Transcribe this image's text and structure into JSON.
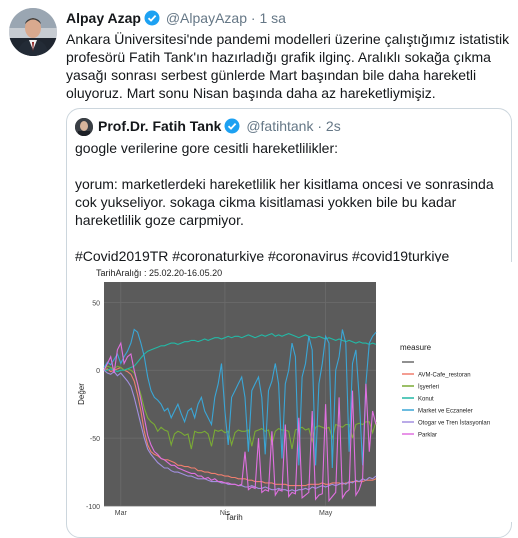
{
  "tweet": {
    "author_name": "Alpay Azap",
    "author_handle": "@AlpayAzap",
    "separator": "·",
    "time": "1 sa",
    "text": "Ankara Üniversitesi'nde pandemi modelleri üzerine çalıştığımız istatistik profesörü Fatih Tank'ın hazırladığı  grafik ilginç. Aralıklı sokağa çıkma yasağı sonrası serbest günlerde Mart başından bile daha hareketli oluyoruz. Mart sonu Nisan başında daha az hareketliymişiz."
  },
  "quote": {
    "author_name": "Prof.Dr. Fatih Tank",
    "author_handle": "@fatihtank",
    "separator": "·",
    "time": "2s",
    "text": "google verilerine gore cesitli hareketlilikler:\n\nyorum: marketlerdeki hareketlilik her kisitlama oncesi ve sonrasinda cok yukseliyor. sokaga cikma kisitlamasi yokken bile bu kadar hareketlilik goze carpmiyor.\n\n#Covid2019TR #coronaturkiye #coronavirus #covid19turkiye"
  },
  "chart_data": {
    "type": "line",
    "title": "TarihAralığı : 25.02.20-16.05.20",
    "xlabel": "Tarih",
    "ylabel": "Değer",
    "x_ticks": [
      "Mar",
      "Nis",
      "May"
    ],
    "y_ticks": [
      -100,
      -50,
      0,
      50
    ],
    "ylim": [
      -100,
      65
    ],
    "x_start": "2020-02-25",
    "x_end": "2020-05-16",
    "legend_title": "measure",
    "legend_position": "right",
    "series": [
      {
        "name": "AVM-Cafe_restoran",
        "color": "#f07e6e",
        "values": [
          0,
          1,
          -1,
          0,
          1,
          2,
          0,
          -1,
          -3,
          -8,
          -18,
          -30,
          -45,
          -55,
          -60,
          -62,
          -63,
          -65,
          -66,
          -66,
          -67,
          -68,
          -70,
          -70,
          -71,
          -71,
          -72,
          -72,
          -74,
          -74,
          -75,
          -75,
          -76,
          -76,
          -77,
          -77,
          -78,
          -78,
          -79,
          -79,
          -80,
          -80,
          -80,
          -81,
          -81,
          -82,
          -82,
          -82,
          -83,
          -83,
          -83,
          -84,
          -84,
          -84,
          -84,
          -85,
          -85,
          -85,
          -85,
          -85,
          -85,
          -84,
          -84,
          -84,
          -84,
          -83,
          -84,
          -84,
          -83,
          -83,
          -83,
          -84,
          -83,
          -83,
          -82,
          -82,
          -82,
          -82,
          -81,
          -81,
          -81,
          -80
        ]
      },
      {
        "name": "İşyerleri",
        "color": "#7aab35",
        "values": [
          0,
          3,
          2,
          1,
          3,
          2,
          0,
          1,
          0,
          -2,
          -10,
          -18,
          -28,
          -35,
          -38,
          -40,
          -45,
          -42,
          -44,
          -45,
          -55,
          -47,
          -45,
          -46,
          -48,
          -47,
          -58,
          -45,
          -46,
          -46,
          -45,
          -47,
          -56,
          -44,
          -45,
          -44,
          -46,
          -45,
          -55,
          -46,
          -44,
          -45,
          -45,
          -44,
          -56,
          -45,
          -44,
          -43,
          -45,
          -44,
          -55,
          -45,
          -43,
          -44,
          -44,
          -45,
          -58,
          -44,
          -43,
          -42,
          -44,
          -43,
          -52,
          -42,
          -41,
          -42,
          -43,
          -42,
          -50,
          -40,
          -41,
          -42,
          -40,
          -40,
          -50,
          -40,
          -39,
          -40,
          -38,
          -38,
          -46,
          -38
        ]
      },
      {
        "name": "Konut",
        "color": "#23b9a6",
        "values": [
          0,
          0,
          1,
          0,
          -1,
          0,
          0,
          1,
          2,
          3,
          6,
          9,
          12,
          14,
          15,
          16,
          17,
          18,
          18,
          19,
          20,
          20,
          19,
          20,
          21,
          21,
          22,
          22,
          21,
          22,
          23,
          22,
          23,
          24,
          24,
          23,
          24,
          25,
          24,
          25,
          25,
          24,
          25,
          26,
          25,
          24,
          25,
          26,
          25,
          26,
          27,
          25,
          26,
          25,
          26,
          27,
          26,
          25,
          24,
          25,
          26,
          25,
          24,
          24,
          25,
          24,
          23,
          24,
          23,
          22,
          23,
          22,
          21,
          22,
          21,
          20,
          21,
          20,
          20,
          19,
          20,
          19
        ]
      },
      {
        "name": "Market ve Eczaneler",
        "color": "#3aa6d6",
        "values": [
          2,
          6,
          4,
          8,
          12,
          5,
          10,
          14,
          20,
          30,
          28,
          20,
          10,
          -5,
          -15,
          -20,
          -22,
          -25,
          -30,
          -28,
          -35,
          -30,
          -25,
          -32,
          -38,
          -30,
          -28,
          -35,
          -25,
          -20,
          -30,
          -35,
          -40,
          -20,
          -10,
          5,
          -30,
          -55,
          -20,
          -15,
          -10,
          -5,
          -20,
          -60,
          -15,
          -10,
          -5,
          -20,
          -62,
          -15,
          -8,
          5,
          -10,
          -65,
          -10,
          0,
          20,
          10,
          -70,
          -5,
          5,
          25,
          15,
          -70,
          -10,
          5,
          25,
          20,
          -72,
          0,
          10,
          30,
          20,
          -60,
          5,
          15,
          -20,
          -70,
          -10,
          20,
          25,
          28
        ]
      },
      {
        "name": "Otogar ve Tren İstasyonları",
        "color": "#a28fe0",
        "values": [
          0,
          -2,
          -3,
          -1,
          -4,
          -2,
          -5,
          -8,
          -12,
          -20,
          -30,
          -40,
          -50,
          -58,
          -62,
          -65,
          -68,
          -70,
          -72,
          -72,
          -74,
          -75,
          -75,
          -76,
          -77,
          -78,
          -78,
          -79,
          -80,
          -80,
          -80,
          -81,
          -82,
          -82,
          -82,
          -83,
          -83,
          -84,
          -84,
          -84,
          -85,
          -85,
          -86,
          -86,
          -85,
          -86,
          -87,
          -87,
          -86,
          -87,
          -88,
          -88,
          -87,
          -88,
          -88,
          -89,
          -88,
          -89,
          -88,
          -88,
          -87,
          -88,
          -86,
          -87,
          -86,
          -85,
          -86,
          -85,
          -84,
          -85,
          -84,
          -83,
          -84,
          -82,
          -83,
          -81,
          -82,
          -80,
          -81,
          -79,
          -80,
          -78
        ]
      },
      {
        "name": "Parklar",
        "color": "#e070e0",
        "values": [
          0,
          5,
          10,
          -2,
          15,
          20,
          5,
          10,
          12,
          0,
          -10,
          -22,
          -35,
          -48,
          -55,
          -60,
          -62,
          -65,
          -66,
          -68,
          -70,
          -70,
          -72,
          -73,
          -74,
          -75,
          -76,
          -76,
          -78,
          -78,
          -80,
          -79,
          -81,
          -80,
          -82,
          -82,
          -83,
          -83,
          -84,
          -84,
          -85,
          -84,
          -60,
          -88,
          -86,
          -87,
          -50,
          -90,
          -88,
          -89,
          -45,
          -92,
          -88,
          -89,
          -40,
          -93,
          -90,
          -91,
          -35,
          -94,
          -92,
          -90,
          -30,
          -95,
          -92,
          -91,
          -25,
          -96,
          -93,
          -90,
          -20,
          -94,
          -90,
          -88,
          -15,
          -92,
          -88,
          -80,
          -10,
          -60,
          -30,
          -40
        ]
      }
    ]
  }
}
